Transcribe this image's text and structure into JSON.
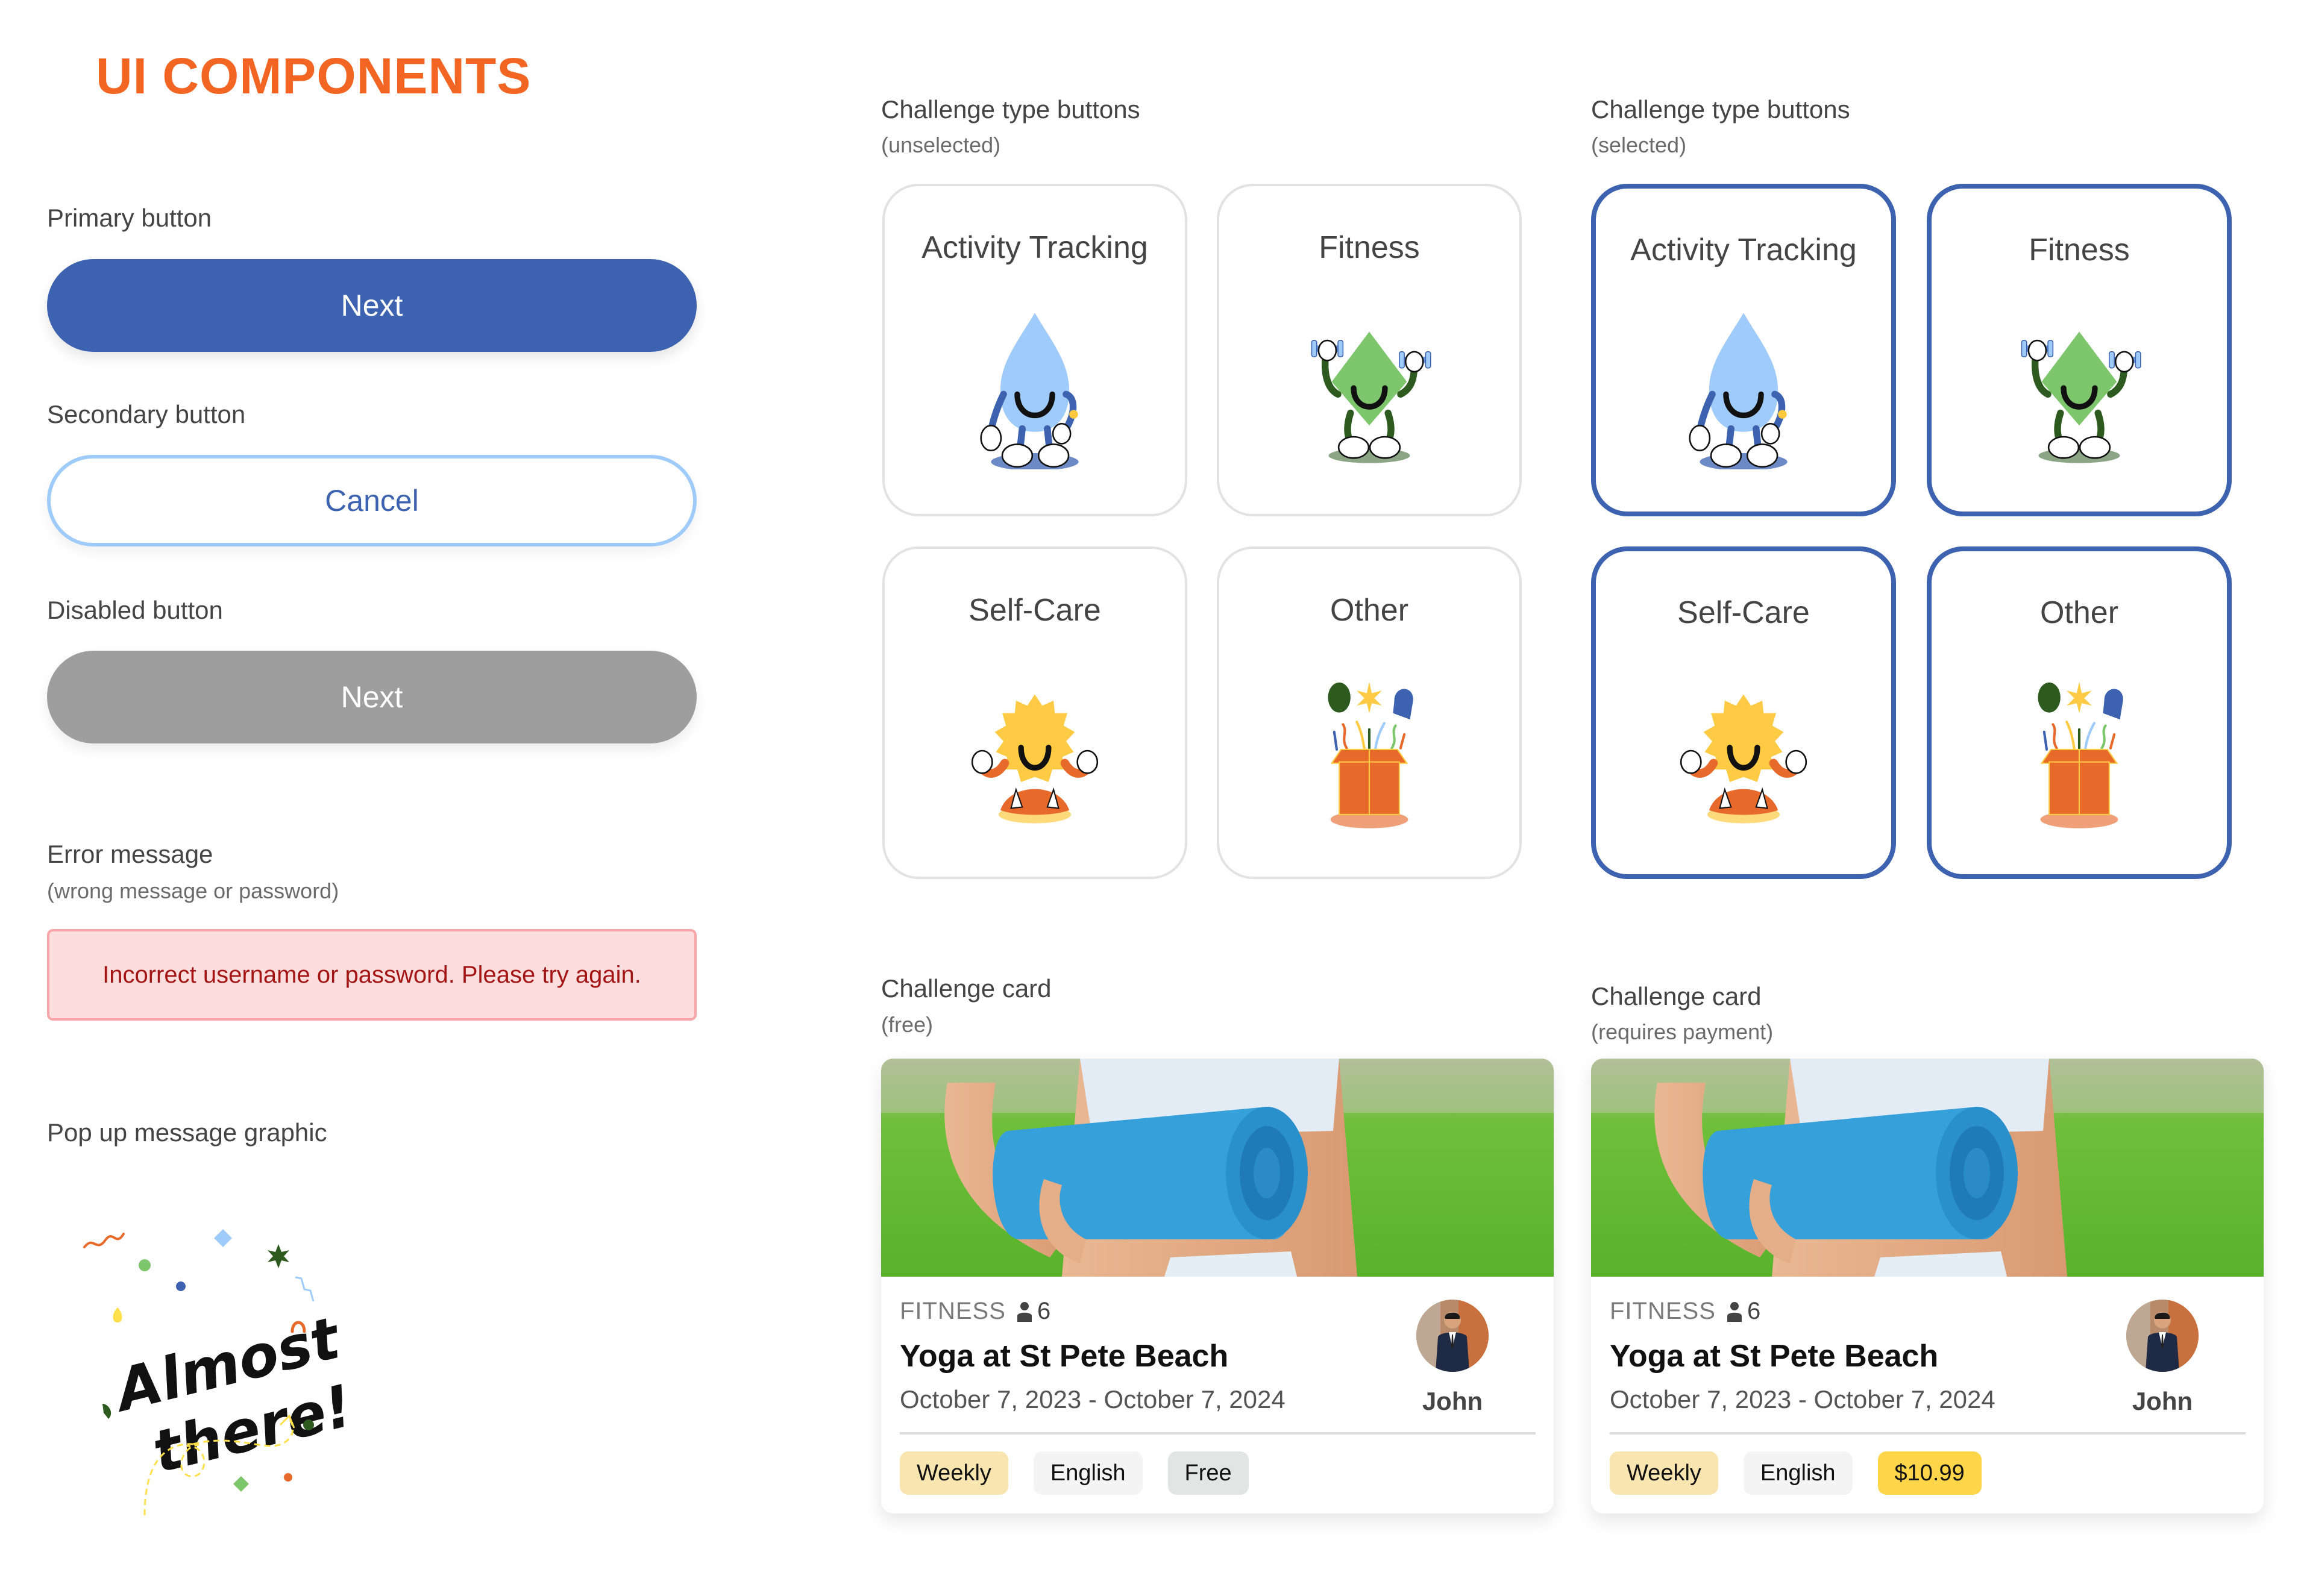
{
  "page": {
    "title": "UI COMPONENTS",
    "accent_color": "#F26522"
  },
  "buttons": {
    "primary": {
      "section_label": "Primary button",
      "label": "Next",
      "color": "#3D62AF"
    },
    "secondary": {
      "section_label": "Secondary button",
      "label": "Cancel",
      "border_color": "#9ECBFA"
    },
    "disabled": {
      "section_label": "Disabled button",
      "label": "Next",
      "color": "#9E9E9E"
    }
  },
  "error": {
    "section_label": "Error message",
    "section_sublabel": "(wrong message or password)",
    "message": "Incorrect username or password. Please try again."
  },
  "popup": {
    "section_label": "Pop up message graphic",
    "line1": "Almost",
    "line2": "there!"
  },
  "challenge_types_unselected": {
    "section_label": "Challenge type buttons",
    "section_sublabel": "(unselected)",
    "items": [
      {
        "label": "Activity Tracking",
        "icon": "water-drop-mascot-icon"
      },
      {
        "label": "Fitness",
        "icon": "diamond-dumbbell-mascot-icon"
      },
      {
        "label": "Self-Care",
        "icon": "sun-meditating-mascot-icon"
      },
      {
        "label": "Other",
        "icon": "gift-box-icon"
      }
    ]
  },
  "challenge_types_selected": {
    "section_label": "Challenge type buttons",
    "section_sublabel": "(selected)",
    "selected_border_color": "#3D62AF",
    "items": [
      {
        "label": "Activity Tracking",
        "icon": "water-drop-mascot-icon"
      },
      {
        "label": "Fitness",
        "icon": "diamond-dumbbell-mascot-icon"
      },
      {
        "label": "Self-Care",
        "icon": "sun-meditating-mascot-icon"
      },
      {
        "label": "Other",
        "icon": "gift-box-icon"
      }
    ]
  },
  "challenge_cards": [
    {
      "section_label": "Challenge card",
      "section_sublabel": "(free)",
      "category": "FITNESS",
      "members": "6",
      "title": "Yoga at St Pete Beach",
      "dates": "October 7, 2023 - October 7, 2024",
      "host": "John",
      "tags": [
        "Weekly",
        "English",
        "Free"
      ]
    },
    {
      "section_label": "Challenge card",
      "section_sublabel": "(requires payment)",
      "category": "FITNESS",
      "members": "6",
      "title": "Yoga at St Pete Beach",
      "dates": "October 7, 2023 - October 7, 2024",
      "host": "John",
      "tags": [
        "Weekly",
        "English",
        "$10.99"
      ]
    }
  ]
}
